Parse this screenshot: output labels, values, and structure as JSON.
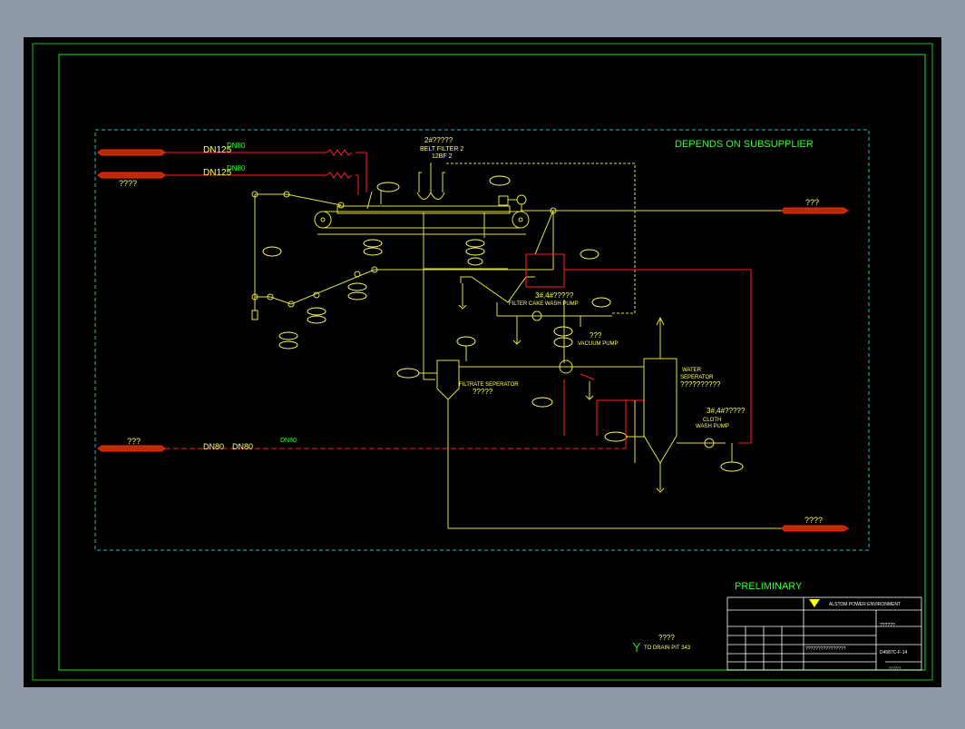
{
  "colors": {
    "background": "#000000",
    "frame": "#18c018",
    "process_line": "#e0e040",
    "hot_line": "#ff2020",
    "boundary": "#20c0c0",
    "text_yellow": "#ffff60",
    "text_green": "#30ff30",
    "tag_fill": "#b03000"
  },
  "title_note": "DEPENDS ON SUBSUPPLIER",
  "preliminary": "PRELIMINARY",
  "belt_filter": {
    "code": "2#?????",
    "name": "BELT FILTER 2",
    "tag": "12BF 2"
  },
  "pipes": {
    "dn125_a": "DN125",
    "dn80_a": "DN80",
    "dn125_b": "DN125",
    "dn80_b": "DN80",
    "q_left": "????",
    "q_top_right": "???",
    "q_process_water": "???",
    "dn80_c": "DN80",
    "dn80_d": "DN80",
    "dn80_e": "DN80",
    "q_bottom_right": "????"
  },
  "equipment": {
    "filter_cake_pump_code": "3#,4#?????",
    "filter_cake_pump": "FILTER CAKE WASH PUMP",
    "vacuum_pump_code": "???",
    "vacuum_pump": "VACUUM PUMP",
    "filtrate_sep": "FILTRATE SEPERATOR",
    "filtrate_sep_code": "?????",
    "water_sep_1": "WATER",
    "water_sep_2": "SEPERATOR",
    "water_sep_code": "??????????",
    "cloth_pump_code": "3#,4#?????",
    "cloth_pump_1": "CLOTH",
    "cloth_pump_2": "WASH PUMP"
  },
  "drain_note": {
    "code": "????",
    "text": "TO DRAIN PIT 343"
  },
  "title_block": {
    "company": "ALSTOM POWER ENVIRONMENT",
    "r2": "??????",
    "drawing_no": "D4587C-F-14",
    "d2": "??????",
    "desc": "????????????????"
  }
}
